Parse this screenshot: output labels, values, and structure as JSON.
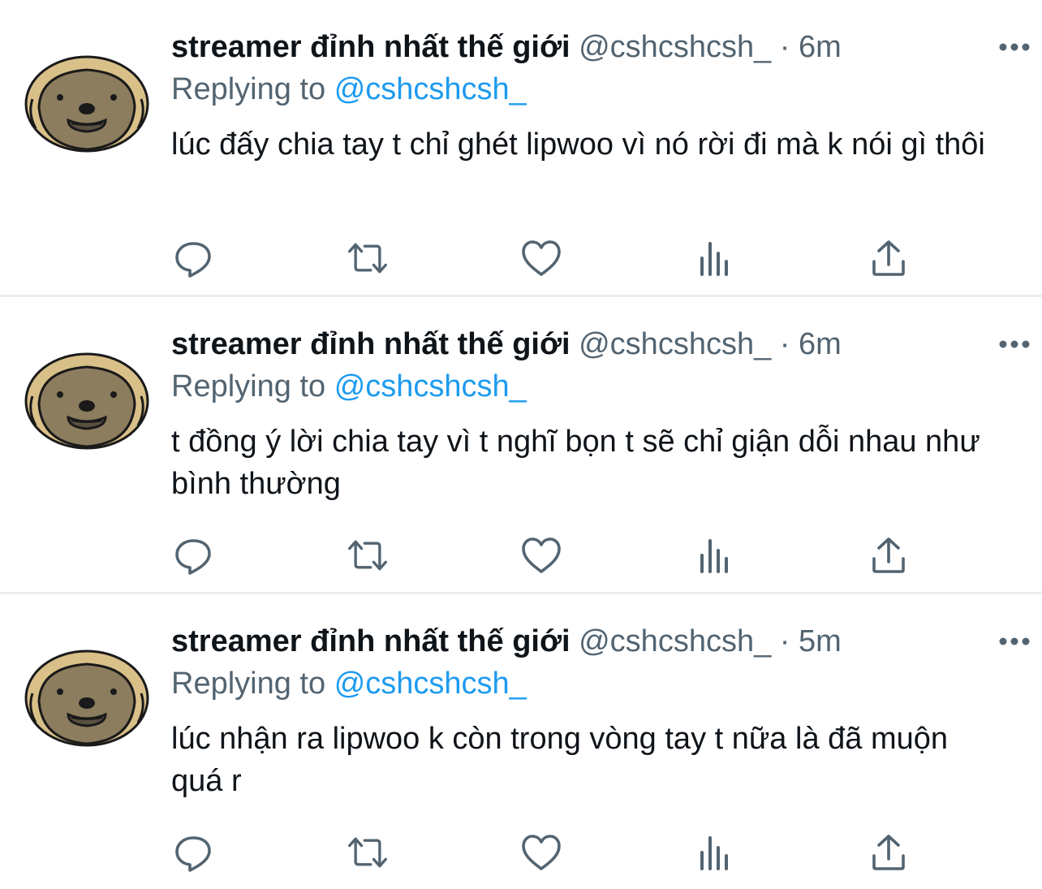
{
  "colors": {
    "text": "#0f1419",
    "secondary": "#536471",
    "mention": "#1d9bf0",
    "divider": "#ebeef0"
  },
  "tweets": [
    {
      "name": "streamer đỉnh nhất thế giới",
      "handle": "@cshcshcsh_",
      "separator": "·",
      "time": "6m",
      "replying_label": "Replying to",
      "replying_to": "@cshcshcsh_",
      "text": "lúc đấy chia tay t chỉ ghét lipwoo vì nó rời đi mà k nói gì thôi"
    },
    {
      "name": "streamer đỉnh nhất thế giới",
      "handle": "@cshcshcsh_",
      "separator": "·",
      "time": "6m",
      "replying_label": "Replying to",
      "replying_to": "@cshcshcsh_",
      "text": "t đồng ý lời chia tay vì t nghĩ bọn t sẽ chỉ giận dỗi nhau như bình thường"
    },
    {
      "name": "streamer đỉnh nhất thế giới",
      "handle": "@cshcshcsh_",
      "separator": "·",
      "time": "5m",
      "replying_label": "Replying to",
      "replying_to": "@cshcshcsh_",
      "text": "lúc nhận ra lipwoo k còn trong vòng tay t nữa là đã muộn quá r"
    }
  ],
  "action_icons": [
    "reply-icon",
    "retweet-icon",
    "like-icon",
    "analytics-icon",
    "share-icon"
  ]
}
